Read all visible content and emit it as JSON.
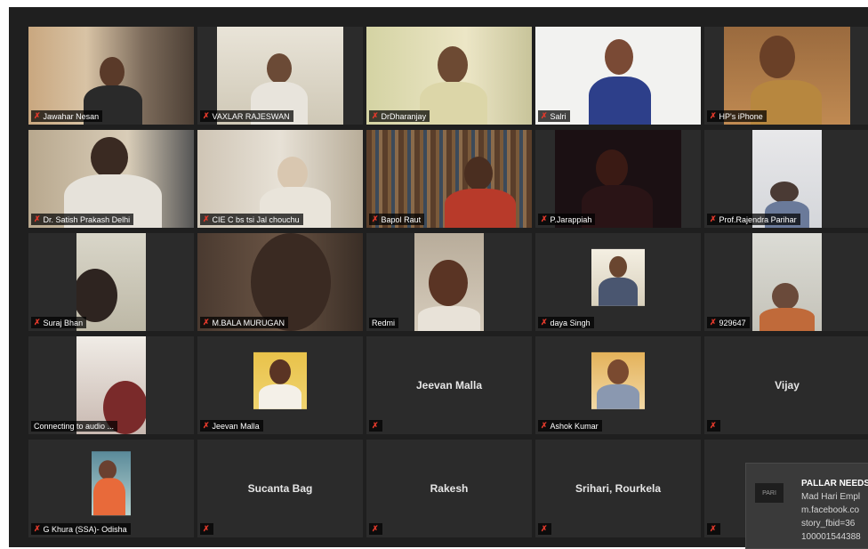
{
  "participants": [
    {
      "name": "Jawahar Nesan",
      "active": true
    },
    {
      "name": "VAXLAR RAJESWAN"
    },
    {
      "name": "DrDharanjay"
    },
    {
      "name": "Salri"
    },
    {
      "name": "HP's iPhone"
    },
    {
      "name": "Dr. Satish Prakash  Delhi"
    },
    {
      "name": "CIE C bs tsi Jal chouchu"
    },
    {
      "name": "Bapol Raut"
    },
    {
      "name": "P.Jarappiah"
    },
    {
      "name": "Prof.Rajendra Parihar"
    },
    {
      "name": "Suraj Bhan"
    },
    {
      "name": "M.BALA MURUGAN"
    },
    {
      "name": "Redmi"
    },
    {
      "name": "daya Singh"
    },
    {
      "name": "929647"
    },
    {
      "name": "Connecting to audio ..."
    },
    {
      "name": "Jeevan Malla"
    },
    {
      "name": "Jeevan Malla",
      "center": true
    },
    {
      "name": "Ashok Kumar"
    },
    {
      "name": "Vijay",
      "center": true
    },
    {
      "name": "G Khura (SSA)- Odisha"
    },
    {
      "name": "Sucanta Bag",
      "center": true
    },
    {
      "name": "Rakesh",
      "center": true
    },
    {
      "name": "Srihari, Rourkela",
      "center": true
    },
    {
      "name": "",
      "center": true
    }
  ],
  "notification": {
    "logo_text": "PARI",
    "title": "PALLAR NEEDS",
    "lines": [
      "Mad Hari Empl",
      "m.facebook.co",
      "story_fbid=36",
      "100001544388"
    ]
  },
  "colors": {
    "active_border": "#e8d25a",
    "muted_mic": "#e0392b",
    "tile_bg": "#2b2b2b",
    "app_bg": "#1f1f1f"
  }
}
